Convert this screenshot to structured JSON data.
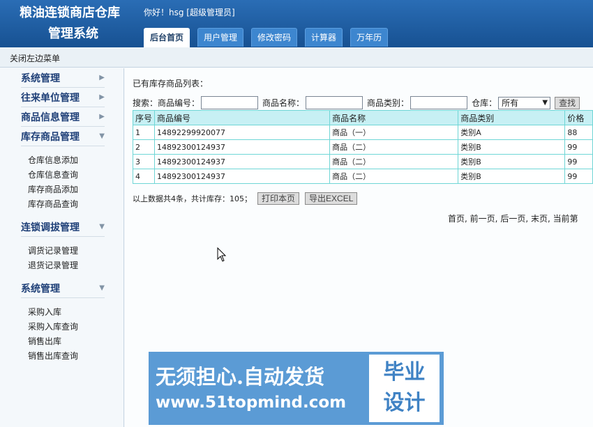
{
  "header": {
    "title_line1": "粮油连锁商店仓库",
    "title_line2": "管理系统",
    "greeting": "你好！hsg [超级管理员]",
    "tabs": [
      "后台首页",
      "用户管理",
      "修改密码",
      "计算器",
      "万年历"
    ]
  },
  "toggle_menu_label": "关闭左边菜单",
  "sidebar": {
    "groups": [
      {
        "title": "系统管理",
        "arrow": "▶",
        "items": []
      },
      {
        "title": "往来单位管理",
        "arrow": "▶",
        "items": []
      },
      {
        "title": "商品信息管理",
        "arrow": "▶",
        "items": []
      },
      {
        "title": "库存商品管理",
        "arrow": "▼",
        "items": [
          "仓库信息添加",
          "仓库信息查询",
          "库存商品添加",
          "库存商品查询"
        ]
      },
      {
        "title": "连锁调拔管理",
        "arrow": "▼",
        "items": [
          "调货记录管理",
          "退货记录管理"
        ]
      },
      {
        "title": "系统管理",
        "arrow": "▼",
        "items": [
          "采购入库",
          "采购入库查询",
          "销售出库",
          "销售出库查询"
        ]
      }
    ]
  },
  "main": {
    "list_title": "已有库存商品列表：",
    "search": {
      "prefix": "搜索：",
      "code_label": "商品编号：",
      "name_label": "商品名称：",
      "category_label": "商品类别：",
      "warehouse_label": "仓库：",
      "warehouse_selected": "所有",
      "search_button": "查找"
    },
    "table": {
      "headers": [
        "序号",
        "商品编号",
        "商品名称",
        "商品类别",
        "价格"
      ],
      "rows": [
        [
          "1",
          "14892299920077",
          "商品（一）",
          "类别A",
          "88"
        ],
        [
          "2",
          "14892300124937",
          "商品（二）",
          "类别B",
          "99"
        ],
        [
          "3",
          "14892300124937",
          "商品（二）",
          "类别B",
          "99"
        ],
        [
          "4",
          "14892300124937",
          "商品（二）",
          "类别B",
          "99"
        ]
      ]
    },
    "summary": "以上数据共4条，共计库存：105；",
    "print_button": "打印本页",
    "export_button": "导出EXCEL",
    "pager": {
      "first": "首页",
      "prev": "前一页",
      "next": "后一页",
      "last": "末页",
      "current": "当前第"
    }
  },
  "banner": {
    "line1": "无须担心.自动发货",
    "line2": "www.51topmind.com",
    "right1": "毕业",
    "right2": "设计"
  }
}
